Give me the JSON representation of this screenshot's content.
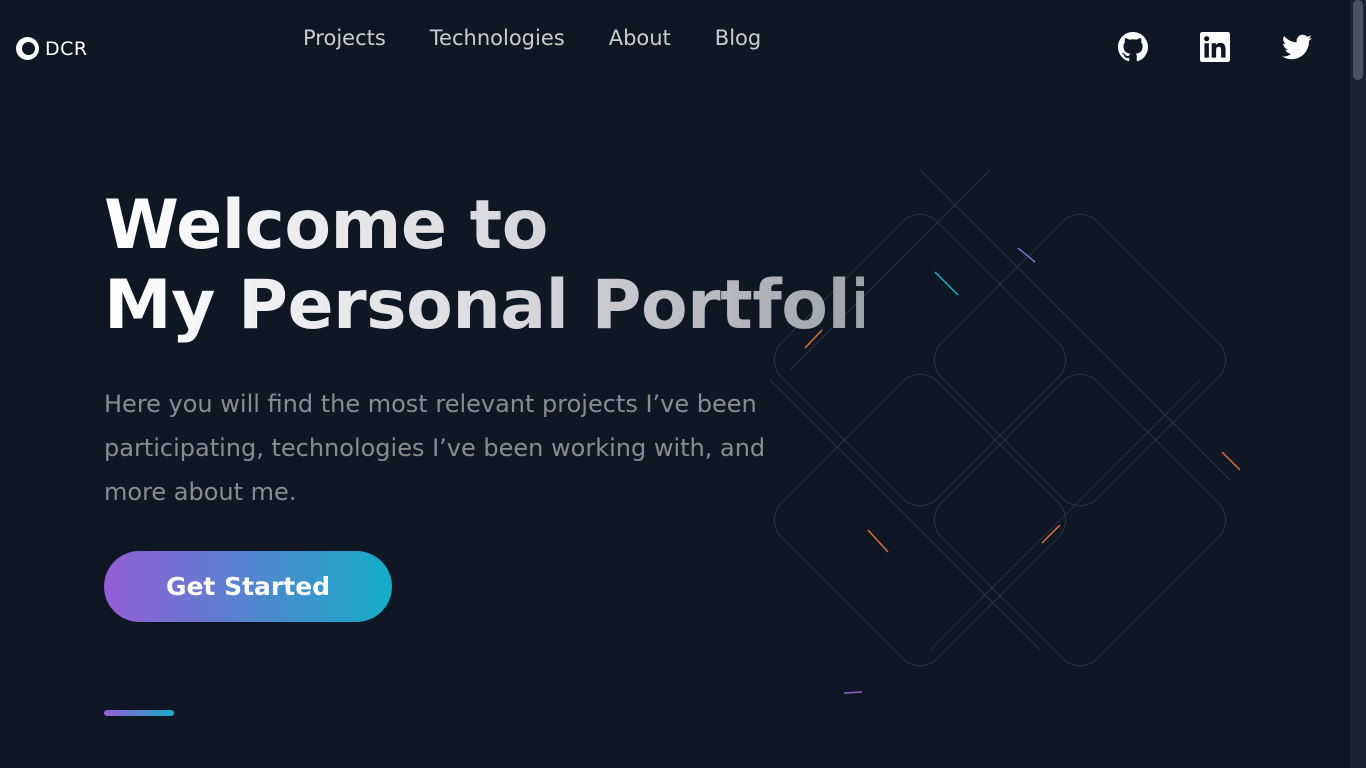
{
  "header": {
    "logo_text": "DCR",
    "nav": [
      {
        "label": "Projects"
      },
      {
        "label": "Technologies"
      },
      {
        "label": "About"
      },
      {
        "label": "Blog"
      }
    ],
    "socials": [
      "github-icon",
      "linkedin-icon",
      "twitter-icon"
    ]
  },
  "hero": {
    "title_line1": "Welcome to",
    "title_line2": "My Personal Portfolio",
    "description": "Here you will find the most relevant projects I’ve been participating, technologies I’ve been working with, and more about me.",
    "cta_label": "Get Started"
  },
  "colors": {
    "background": "#0f1624",
    "gradient_start": "#945dd6",
    "gradient_mid": "#6978d1",
    "gradient_end": "#13adc7"
  }
}
